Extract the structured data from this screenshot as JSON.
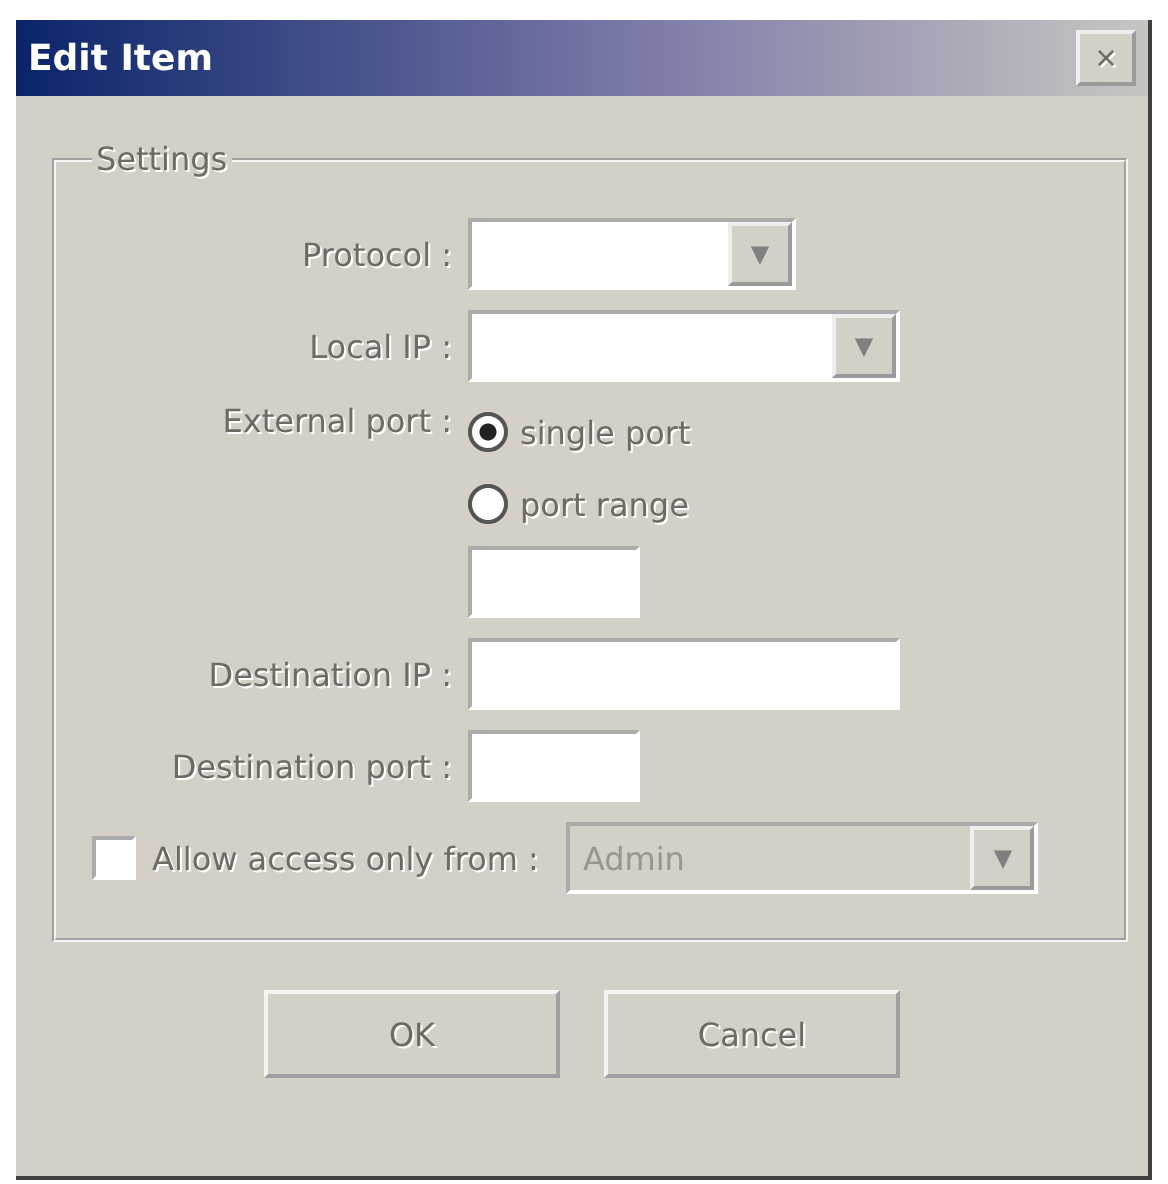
{
  "window": {
    "title": "Edit Item",
    "close": "×"
  },
  "group": {
    "title": "Settings"
  },
  "protocol": {
    "label": "Protocol :",
    "arrow": "▼"
  },
  "local_ip": {
    "label": "Local IP :",
    "arrow": "▼"
  },
  "external_port": {
    "label": "External port :",
    "options": [
      {
        "label": "single port",
        "selected": true
      },
      {
        "label": "port range",
        "selected": false
      }
    ]
  },
  "destination_ip": {
    "label": "Destination IP :"
  },
  "destination_port": {
    "label": "Destination port :"
  },
  "allow_access": {
    "label": "Allow access only from :",
    "checked": false,
    "value": "Admin",
    "disabled": true,
    "arrow": "▼"
  },
  "buttons": [
    "OK",
    "Cancel"
  ]
}
